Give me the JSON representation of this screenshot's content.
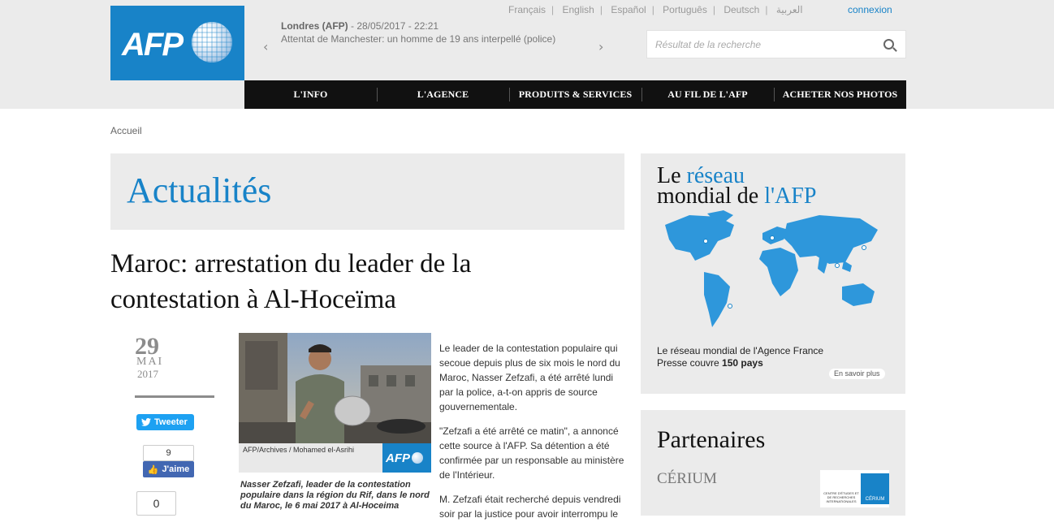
{
  "colors": {
    "accent": "#1883c8",
    "nav_bg": "#111111",
    "panel_bg": "#ebebeb"
  },
  "header": {
    "logo_text": "AFP",
    "ticker": {
      "place": "Londres (AFP)",
      "datetime": " - 28/05/2017 - 22:21",
      "headline": "Attentat de Manchester: un homme de 19 ans interpellé (police)",
      "prev_icon": "chevron-left-icon",
      "next_icon": "chevron-right-icon"
    },
    "languages": [
      "Français",
      "English",
      "Español",
      "Português",
      "Deutsch",
      "العربية"
    ],
    "login_label": "connexion",
    "search": {
      "placeholder": "Résultat de la recherche",
      "icon": "search-icon"
    },
    "nav": [
      "L'INFO",
      "L'AGENCE",
      "PRODUITS & SERVICES",
      "AU FIL DE L'AFP",
      "ACHETER NOS PHOTOS"
    ]
  },
  "breadcrumb": "Accueil",
  "section_title": "Actualités",
  "article": {
    "headline": "Maroc: arrestation du leader de la contestation à Al-Hoceïma",
    "date": {
      "day": "29",
      "month": "MAI",
      "year": "2017"
    },
    "social": {
      "tweet_label": "Tweeter",
      "like_count": "9",
      "like_label": "J'aime",
      "share_count": "0"
    },
    "photo": {
      "credit": "AFP/Archives / Mohamed el-Asrihi",
      "badge": "AFP",
      "caption": "Nasser Zefzafi, leader de la contestation populaire dans la région du Rif, dans le nord du Maroc, le 6 mai 2017 à Al-Hoceima"
    },
    "paragraphs": [
      "Le leader de la contestation populaire qui secoue depuis plus de six mois le nord du Maroc, Nasser Zefzafi, a été arrêté lundi par la police, a-t-on appris de source gouvernementale.",
      "\"Zefzafi a été arrêté ce matin\", a annoncé cette source à l'AFP. Sa détention a été confirmée par un responsable au ministère de l'Intérieur.",
      "M. Zefzafi était recherché depuis vendredi soir par la justice pour avoir interrompu le"
    ]
  },
  "sidebar": {
    "network": {
      "title_1": "Le ",
      "title_1_blue": "réseau",
      "title_2": "mondial de ",
      "title_2_blue": "l'AFP",
      "desc": "Le réseau mondial de l'Agence France Presse couvre ",
      "desc_bold": "150 pays",
      "more_label": "En savoir plus"
    },
    "partners": {
      "title": "Partenaires",
      "partner_name": "CÉRIUM",
      "logo_text": "CÉRIUM",
      "logo_subtitle": "CENTRE D'ÉTUDES ET DE RECHERCHES INTERNATIONALES"
    }
  }
}
